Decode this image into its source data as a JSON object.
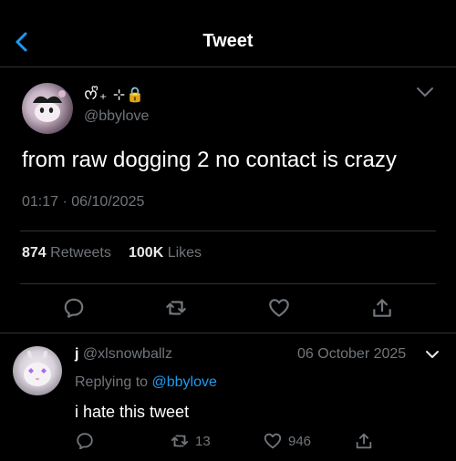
{
  "header": {
    "title": "Tweet"
  },
  "tweet": {
    "display_name": "ᰔᩚ₊ ⊹🔒",
    "handle": "@bbylove",
    "text": "from raw dogging 2 no contact is crazy",
    "time": "01:17",
    "date": "06/10/2025",
    "separator": "·",
    "retweets_count": "874",
    "retweets_label": "Retweets",
    "likes_count": "100K",
    "likes_label": "Likes"
  },
  "reply": {
    "display_name": "j",
    "handle": "@xlsnowballz",
    "date": "06 October 2025",
    "replying_prefix": "Replying to",
    "replying_to": "@bbylove",
    "text": "i hate this tweet",
    "retweet_count": "13",
    "like_count": "946"
  },
  "colors": {
    "accent": "#1d9bf0",
    "background": "#000000",
    "muted": "#71767b",
    "divider": "#2f3336"
  }
}
